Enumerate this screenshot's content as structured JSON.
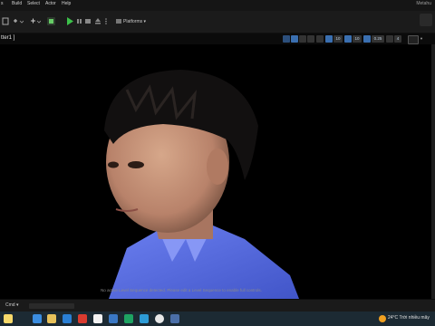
{
  "menu": {
    "items": [
      "s",
      "Build",
      "Select",
      "Actor",
      "Help"
    ],
    "app_title": "Metahu"
  },
  "toolbar": {
    "platforms_label": "Platforms"
  },
  "viewport": {
    "title": "tter1 ]",
    "icon_labels": [
      "10",
      "10",
      "0.25",
      "4"
    ],
    "message": "No active Level Sequence detected. Please edit a Level Sequence to enable full controls."
  },
  "status": {
    "cmd_label": "Cmd"
  },
  "taskbar": {
    "weather": "24°C  Trời nhiều mây"
  },
  "colors": {
    "shirt": "#5a6ee0",
    "skin": "#c9967a",
    "hair": "#121010",
    "play_green": "#3cc14a"
  }
}
